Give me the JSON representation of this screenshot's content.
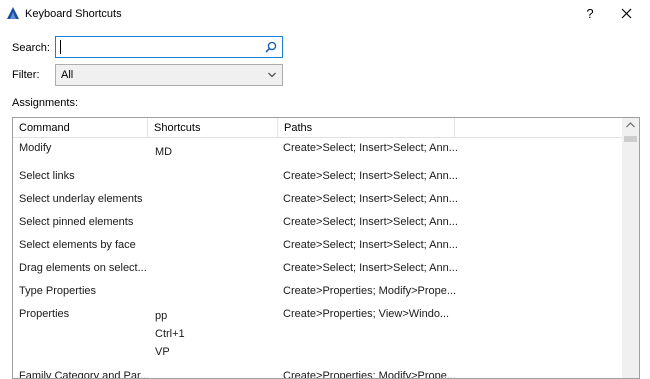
{
  "window": {
    "title": "Keyboard Shortcuts",
    "help_label": "?",
    "close_label": "close"
  },
  "search": {
    "label": "Search:",
    "value": "",
    "placeholder": ""
  },
  "filter": {
    "label": "Filter:",
    "selected": "All"
  },
  "assignments": {
    "label": "Assignments:",
    "columns": [
      "Command",
      "Shortcuts",
      "Paths"
    ],
    "rows": [
      {
        "command": "Modify",
        "shortcuts": [
          "MD"
        ],
        "path": "Create>Select; Insert>Select; Ann..."
      },
      {
        "command": "Select links",
        "shortcuts": [],
        "path": "Create>Select; Insert>Select; Ann..."
      },
      {
        "command": "Select underlay elements",
        "shortcuts": [],
        "path": "Create>Select; Insert>Select; Ann..."
      },
      {
        "command": "Select pinned elements",
        "shortcuts": [],
        "path": "Create>Select; Insert>Select; Ann..."
      },
      {
        "command": "Select elements by face",
        "shortcuts": [],
        "path": "Create>Select; Insert>Select; Ann..."
      },
      {
        "command": "Drag elements on select...",
        "shortcuts": [],
        "path": "Create>Select; Insert>Select; Ann..."
      },
      {
        "command": "Type Properties",
        "shortcuts": [],
        "path": "Create>Properties; Modify>Prope..."
      },
      {
        "command": "Properties",
        "shortcuts": [
          "pp",
          "Ctrl+1",
          "VP"
        ],
        "path": "Create>Properties; View>Windo..."
      },
      {
        "command": "Family Category and Par...",
        "shortcuts": [],
        "path": "Create>Properties; Modify>Prope..."
      }
    ]
  },
  "colors": {
    "accent": "#1c7fd6",
    "border": "#a0a0a0"
  },
  "icons": {
    "app": "revit-logo-icon",
    "search": "magnifier-icon",
    "dropdown": "chevron-down-icon",
    "close": "close-icon"
  }
}
